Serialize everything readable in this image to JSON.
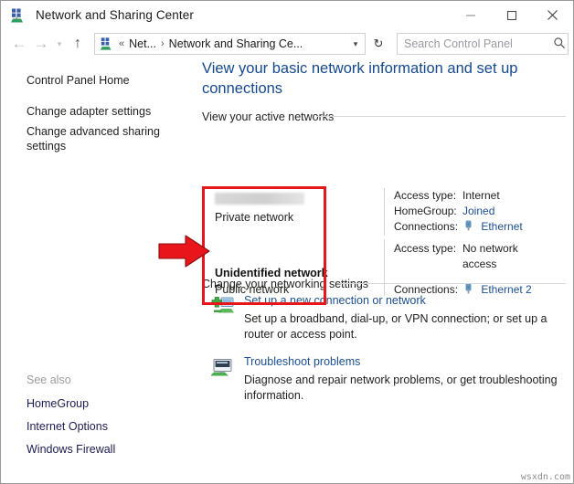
{
  "window": {
    "title": "Network and Sharing Center",
    "icon": "network-sharing-icon",
    "controls": {
      "minimize": "–",
      "maximize": "☐",
      "close": "✕"
    }
  },
  "navbar": {
    "back": "←",
    "forward": "→",
    "recent": "▾",
    "up": "↑",
    "address": {
      "icon": "network-sharing-icon",
      "separator_chevrons": "«",
      "crumb1": "Net...",
      "separator": "›",
      "crumb2": "Network and Sharing Ce...",
      "dropdown": "▾"
    },
    "refresh": "↻",
    "search": {
      "placeholder": "Search Control Panel",
      "value": "",
      "icon": "search-icon"
    }
  },
  "sidebar": {
    "links": [
      {
        "label": "Control Panel Home"
      },
      {
        "label": "Change adapter settings"
      },
      {
        "label": "Change advanced sharing settings"
      }
    ],
    "see_also": {
      "label": "See also",
      "links": [
        {
          "label": "HomeGroup"
        },
        {
          "label": "Internet Options"
        },
        {
          "label": "Windows Firewall"
        }
      ]
    }
  },
  "content": {
    "page_title": "View your basic network information and set up connections",
    "sections": [
      {
        "heading": "View your active networks"
      },
      {
        "heading": "Change your networking settings"
      }
    ],
    "active_networks": [
      {
        "name": "",
        "name_redacted": true,
        "type": "Private network",
        "details": [
          {
            "key": "Access type:",
            "value": "Internet",
            "link": false
          },
          {
            "key": "HomeGroup:",
            "value": "Joined",
            "link": true
          },
          {
            "key": "Connections:",
            "value": "Ethernet",
            "link": true,
            "icon": "ethernet-adapter-icon"
          }
        ]
      },
      {
        "name": "Unidentified network",
        "name_redacted": false,
        "type": "Public network",
        "details": [
          {
            "key": "Access type:",
            "value": "No network access",
            "link": false
          },
          {
            "key": "Connections:",
            "value": "Ethernet 2",
            "link": true,
            "icon": "ethernet-adapter-icon"
          }
        ]
      }
    ],
    "tasks": [
      {
        "icon": "new-connection-icon",
        "link": "Set up a new connection or network",
        "description": "Set up a broadband, dial-up, or VPN connection; or set up a router or access point."
      },
      {
        "icon": "troubleshoot-icon",
        "link": "Troubleshoot problems",
        "description": "Diagnose and repair network problems, or get troubleshooting information."
      }
    ]
  },
  "annotations": {
    "highlight_box": {
      "shape": "rectangle",
      "color": "#e8161a"
    },
    "arrow": {
      "shape": "right-arrow",
      "color": "#e8161a"
    }
  },
  "watermark": "wsxdn.com",
  "colors": {
    "link": "#1c4f8f",
    "title": "#15498f",
    "annotation": "#e8161a",
    "text": "#21211f"
  }
}
